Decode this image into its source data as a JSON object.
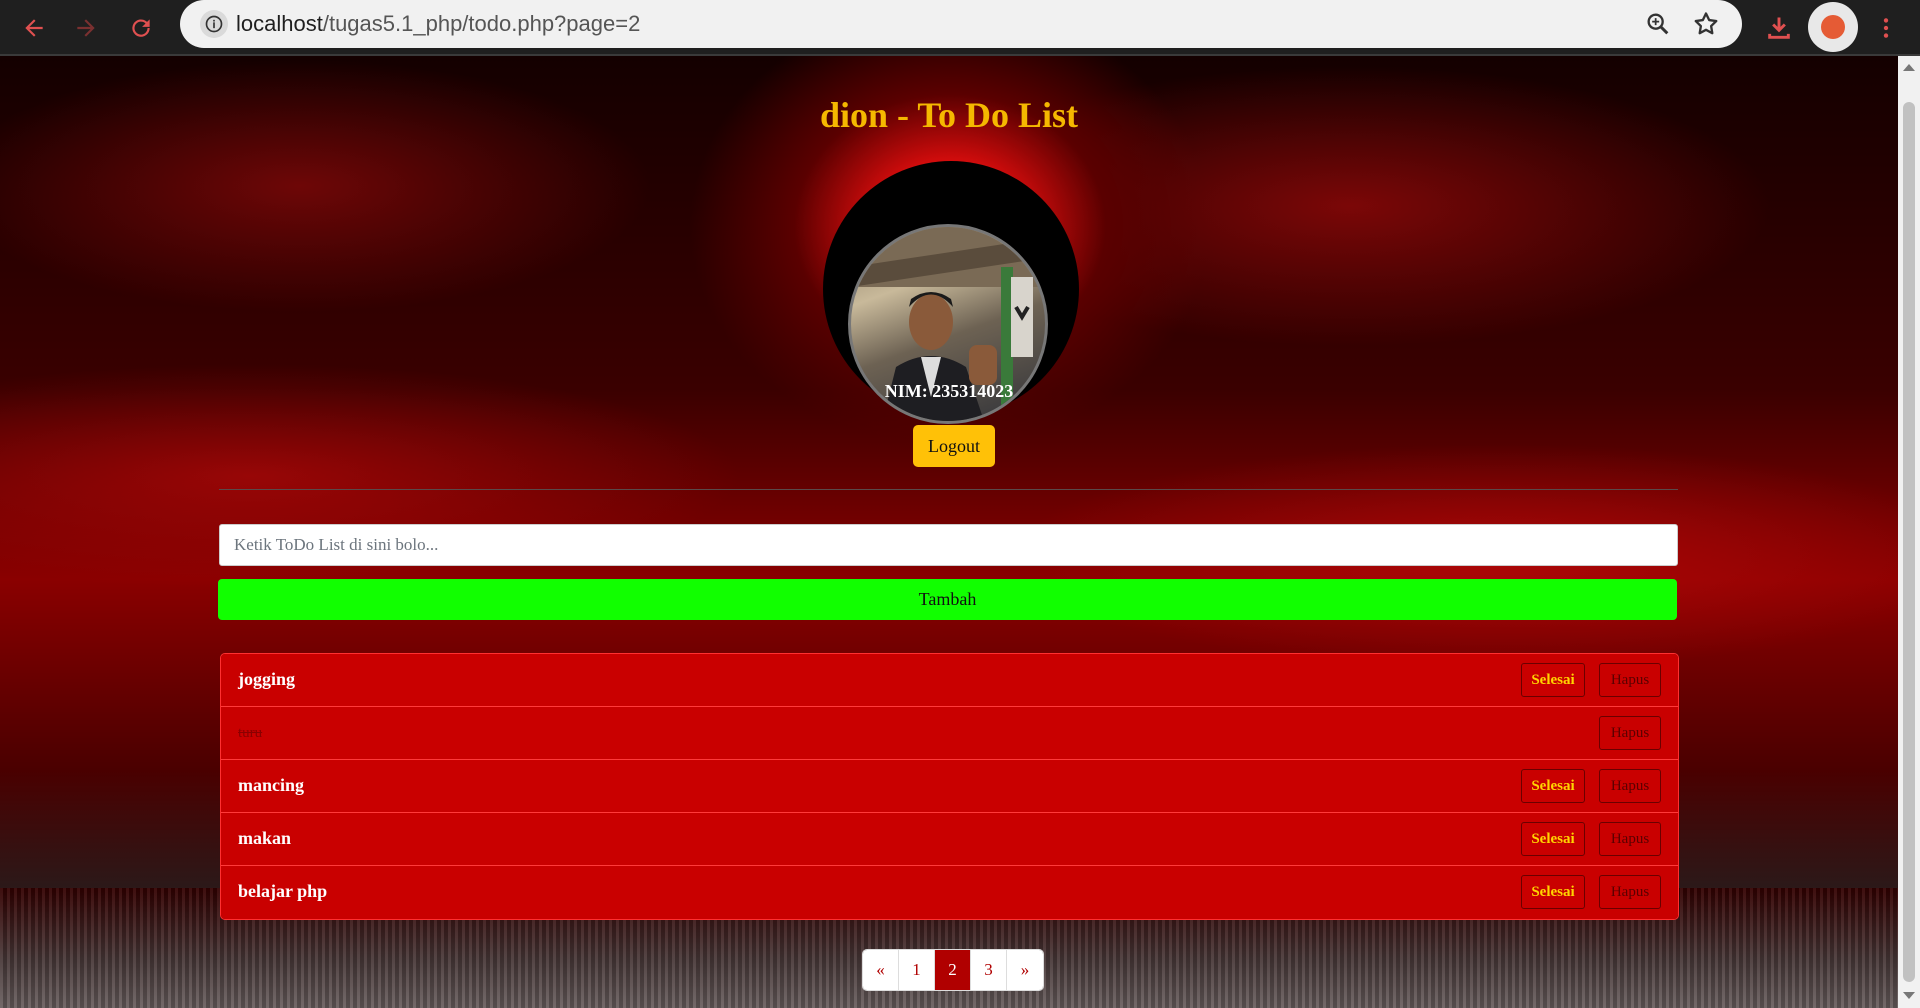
{
  "browser": {
    "url_host": "localhost",
    "url_path": "/tugas5.1_php/todo.php?page=2"
  },
  "page": {
    "title": "dion - To Do List",
    "nim": "NIM: 235314023",
    "logout_label": "Logout",
    "input_placeholder": "Ketik ToDo List di sini bolo...",
    "add_label": "Tambah",
    "done_label": "Selesai",
    "delete_label": "Hapus",
    "todos": [
      {
        "text": "jogging",
        "completed": false
      },
      {
        "text": "turu",
        "completed": true
      },
      {
        "text": "mancing",
        "completed": false
      },
      {
        "text": "makan",
        "completed": false
      },
      {
        "text": "belajar php",
        "completed": false
      }
    ],
    "pagination": {
      "prev": "«",
      "pages": [
        "1",
        "2",
        "3"
      ],
      "current": "2",
      "next": "»"
    }
  },
  "colors": {
    "title": "#f5b800",
    "logout": "#ffc107",
    "add_button": "#11ff00",
    "todo_row": "#c90000",
    "active_page": "#b00000"
  }
}
